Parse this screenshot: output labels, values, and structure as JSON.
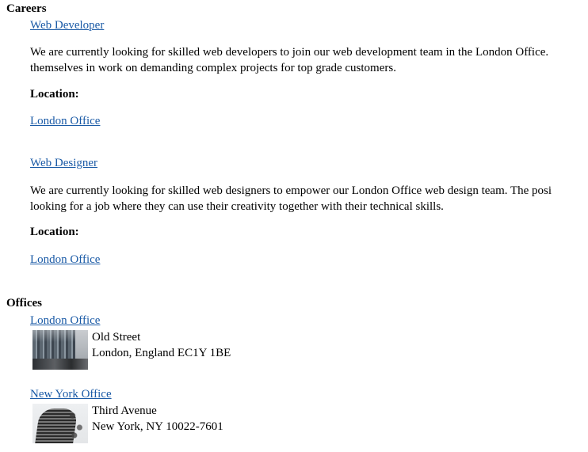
{
  "careers": {
    "title": "Careers",
    "jobs": [
      {
        "title": "Web Developer",
        "description_line1": "We are currently looking for skilled web developers to join our web development team in the London Office.",
        "description_line2": "themselves in work on demanding complex projects for top grade customers.",
        "location_label": "Location:",
        "location": "London Office"
      },
      {
        "title": "Web Designer",
        "description_line1": "We are currently looking for skilled web designers to empower our London Office web design team. The posi",
        "description_line2": "looking for a job where they can use their creativity together with their technical skills.",
        "location_label": "Location:",
        "location": "London Office"
      }
    ]
  },
  "offices": {
    "title": "Offices",
    "items": [
      {
        "name": "London Office",
        "address_line1": "Old Street",
        "address_line2": "London, England EC1Y 1BE"
      },
      {
        "name": "New York Office",
        "address_line1": "Third Avenue",
        "address_line2": "New York, NY 10022-7601"
      }
    ]
  },
  "colors": {
    "link": "#1a5aa6",
    "text": "#000000",
    "background": "#ffffff"
  }
}
